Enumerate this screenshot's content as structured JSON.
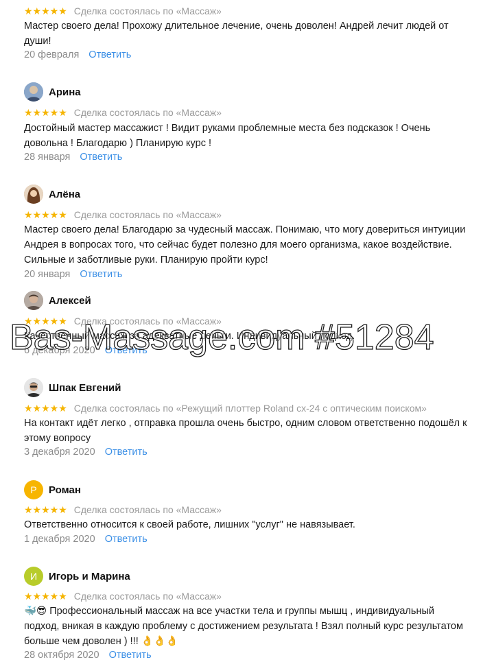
{
  "deal_prefix": "Сделка состоялась по",
  "reply_label": "Ответить",
  "stars": "★★★★★",
  "watermark": "Bas-Massage.com #51284",
  "colors": {
    "accent_link": "#3b8fe6",
    "stars": "#f5b400",
    "muted": "#9a9a9a"
  },
  "reviews": [
    {
      "name": "",
      "deal": "Сделка состоялась по «Массаж»",
      "text": "Мастер своего дела! Прохожу длительное лечение, очень доволен! Андрей лечит людей от души!",
      "date": "20 февраля"
    },
    {
      "name": "Арина",
      "avatar_letter": "",
      "deal": "Сделка состоялась по «Массаж»",
      "text": "Достойный мастер массажист ! Видит руками проблемные места без подсказок ! Очень довольна ! Благодарю ) Планирую курс !",
      "date": "28 января"
    },
    {
      "name": "Алёна",
      "avatar_letter": "",
      "deal": "Сделка состоялась по «Массаж»",
      "text": "Мастер своего дела! Благодарю за чудесный массаж. Понимаю, что могу довериться интуиции Андрея в вопросах того, что сейчас будет полезно для моего организма, какое воздействие. Сильные и заботливые руки. Планирую пройти курс!",
      "date": "20 января"
    },
    {
      "name": "Алексей",
      "avatar_letter": "",
      "deal": "Сделка состоялась по «Массаж»",
      "text": "Качественный массаж за адекватные деньги. Индивидуальный подход.",
      "date": "6 декабря 2020"
    },
    {
      "name": "Шпак Евгений",
      "avatar_letter": "",
      "deal": "Сделка состоялась по «Режущий плоттер Roland cx-24 с оптическим поиском»",
      "text": "На контакт идёт легко , отправка прошла очень быстро, одним словом ответственно подошёл к этому вопросу",
      "date": "3 декабря 2020"
    },
    {
      "name": "Роман",
      "avatar_letter": "Р",
      "deal": "Сделка состоялась по «Массаж»",
      "text": "Ответственно относится к своей работе, лишних \"услуг\" не навязывает.",
      "date": "1 декабря 2020"
    },
    {
      "name": "Игорь и Марина",
      "avatar_letter": "И",
      "deal": "Сделка состоялась по «Массаж»",
      "text": "🐳😎 Профессиональный массаж на все участки тела и группы мышц , индивидуальный подход, вникая в каждую проблему с достижением результата ! Взял полный курс результатом больше чем доволен ) !!! 👌👌👌",
      "date": "28 октября 2020"
    }
  ]
}
